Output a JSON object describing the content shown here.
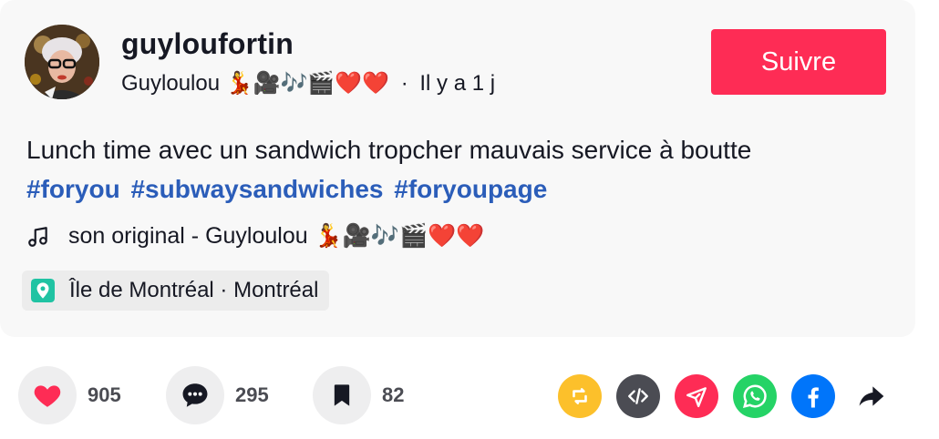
{
  "author": {
    "username": "guyloufortin",
    "display_name": "Guyloulou 💃🎥🎶🎬❤️❤️",
    "separator": "·",
    "time_ago": "Il y a 1 j"
  },
  "follow_label": "Suivre",
  "description": {
    "text": "Lunch time avec un sandwich tropcher mauvais service à boutte",
    "hashtags": [
      "#foryou",
      "#subwaysandwiches",
      "#foryoupage"
    ]
  },
  "music": {
    "label": "son original - Guyloulou 💃🎥🎶🎬❤️❤️",
    "icon": "music-note-icon"
  },
  "location": {
    "label": "Île de Montréal · Montréal",
    "icon": "location-pin-icon"
  },
  "stats": {
    "likes": "905",
    "comments": "295",
    "saves": "82"
  },
  "share_targets": [
    {
      "name": "repost",
      "color": "#fcc02b",
      "icon": "repost-icon"
    },
    {
      "name": "embed",
      "color": "#4b4c53",
      "icon": "embed-code-icon"
    },
    {
      "name": "send-to-friends",
      "color": "#fe2c55",
      "icon": "send-icon"
    },
    {
      "name": "whatsapp",
      "color": "#25d366",
      "icon": "whatsapp-icon"
    },
    {
      "name": "facebook",
      "color": "#0075fa",
      "icon": "facebook-icon"
    },
    {
      "name": "more-share",
      "color": "#161823",
      "icon": "share-arrow-icon"
    }
  ],
  "colors": {
    "accent": "#fe2c55",
    "hashtag": "#2b5db9",
    "like": "#fe2c55"
  }
}
